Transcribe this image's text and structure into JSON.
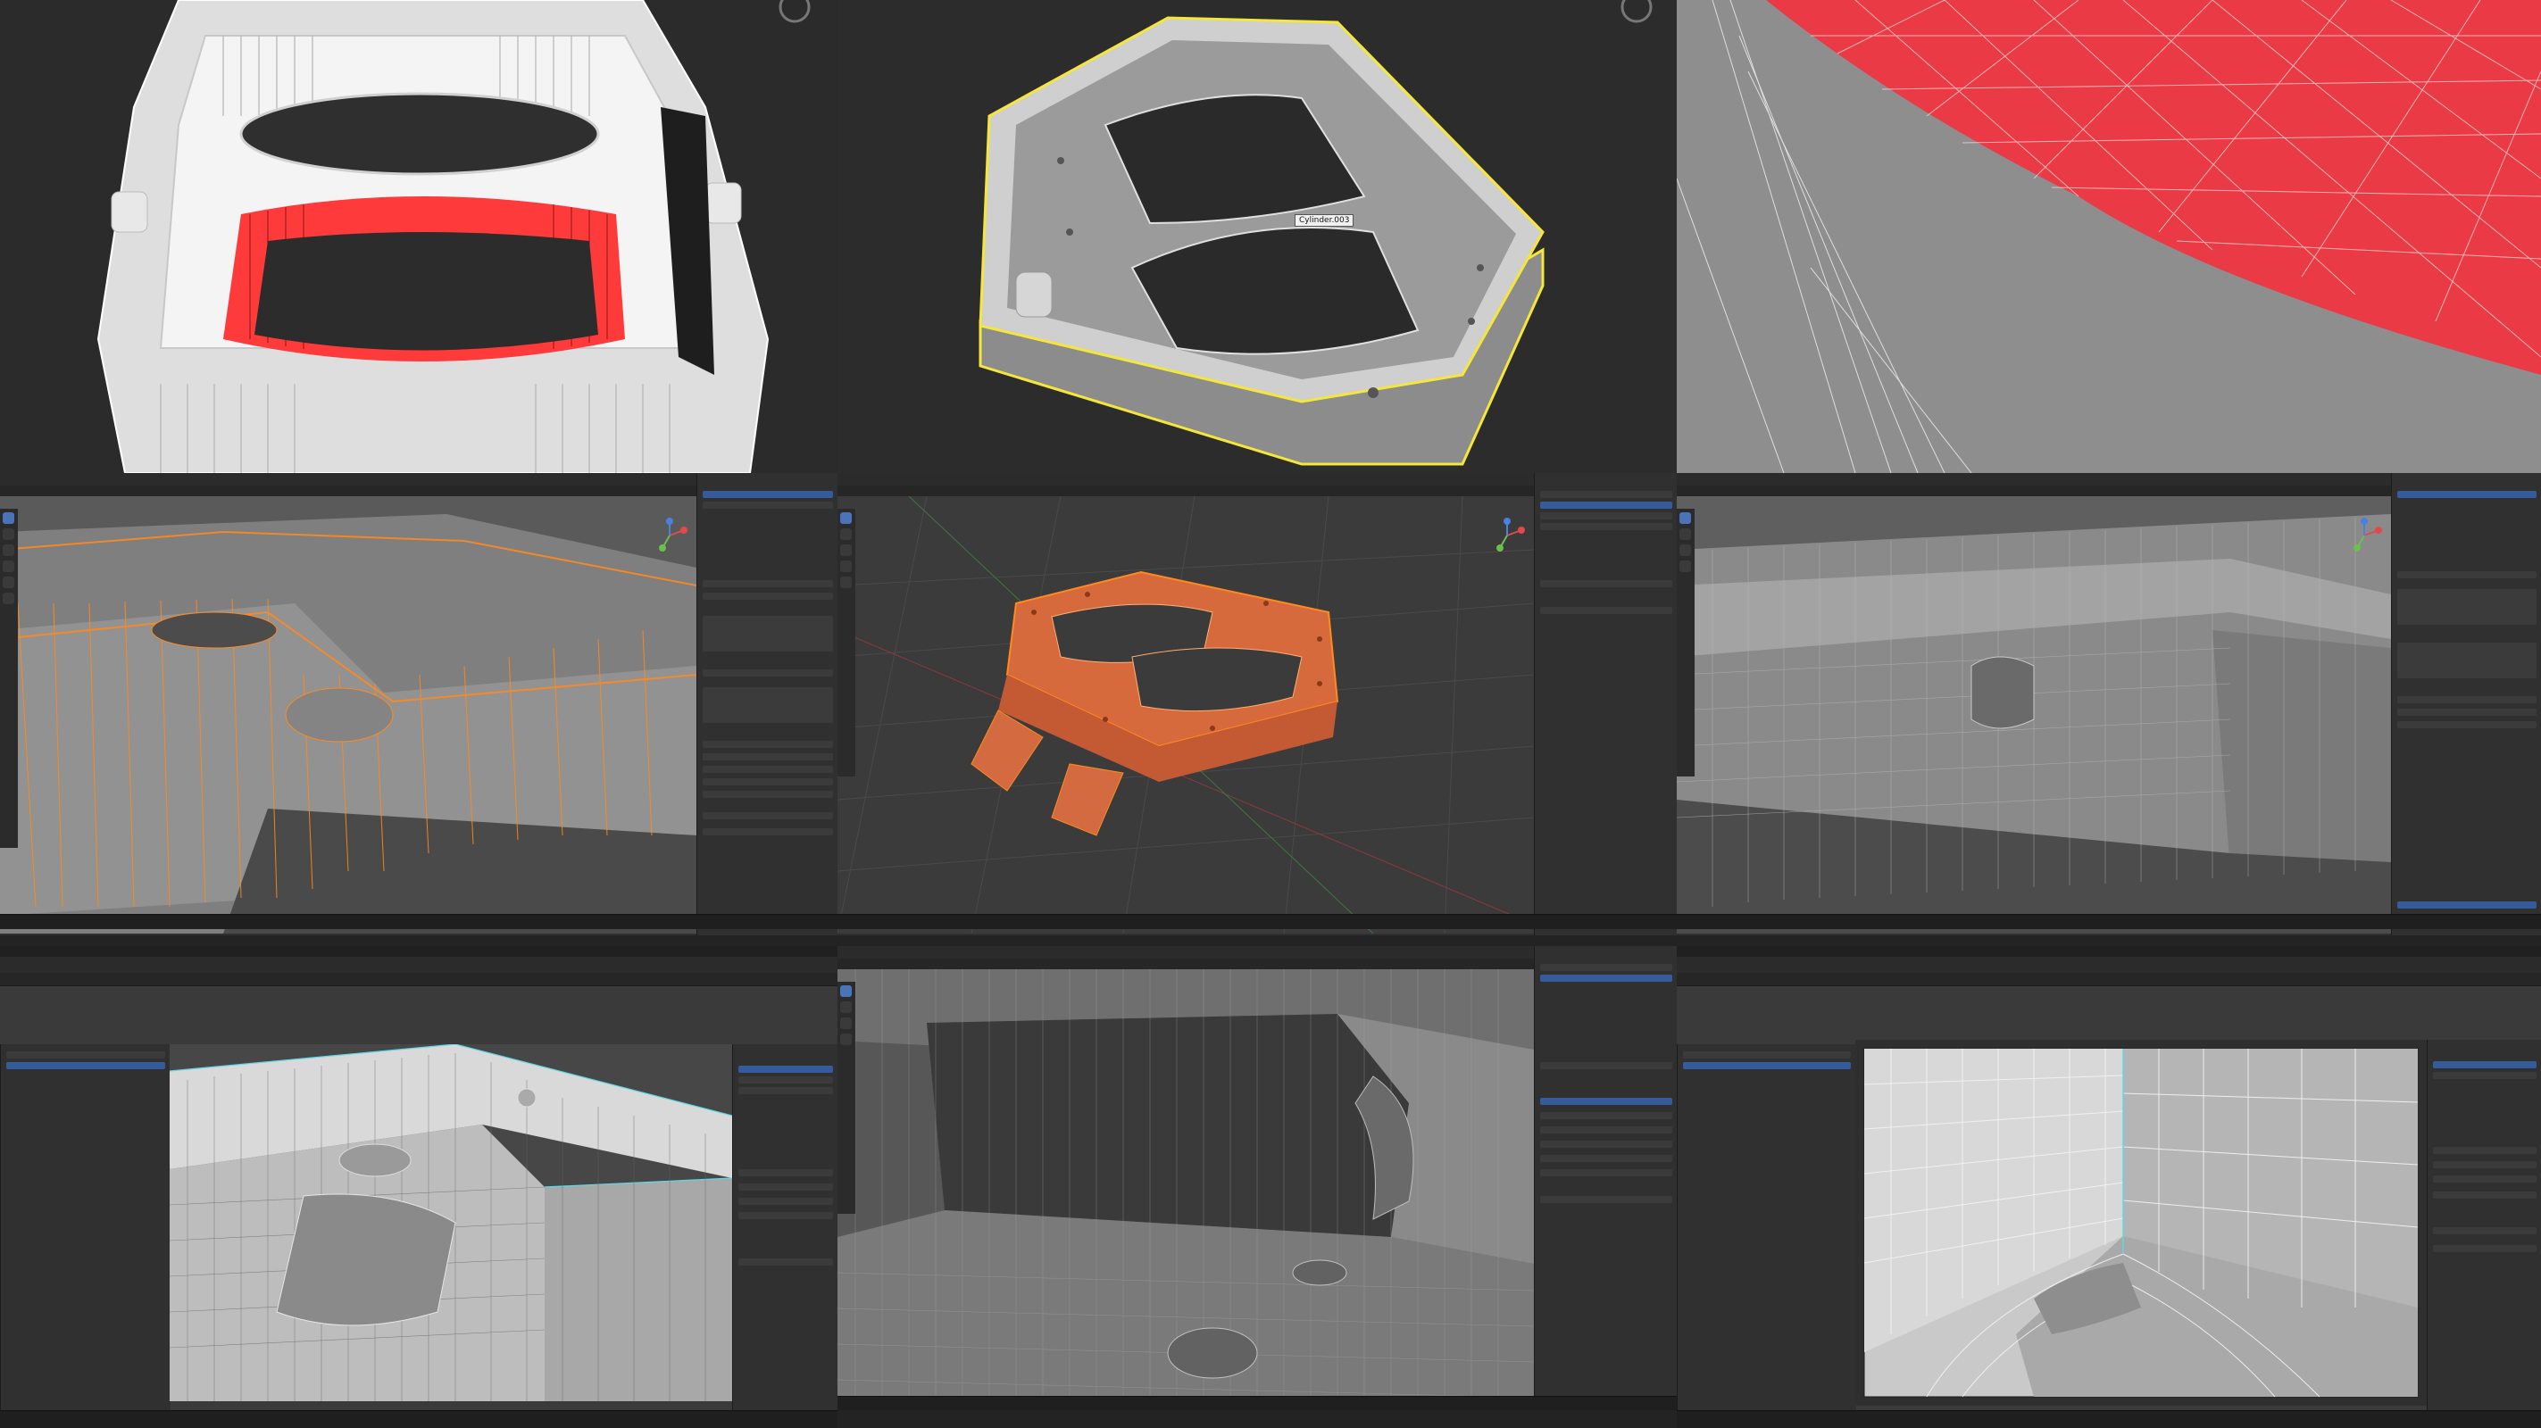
{
  "panels": {
    "p1": {
      "name": "top-left"
    },
    "p2": {
      "name": "top-middle",
      "tooltip": "Cylinder.003"
    },
    "p3": {
      "name": "top-right"
    }
  },
  "colors": {
    "accent_blue": "#4b73b8",
    "selection_orange": "#ff8a1e",
    "face_red": "#e8333b",
    "outline_yellow": "#f4e63a",
    "wire_cyan": "#5fd7e6"
  }
}
